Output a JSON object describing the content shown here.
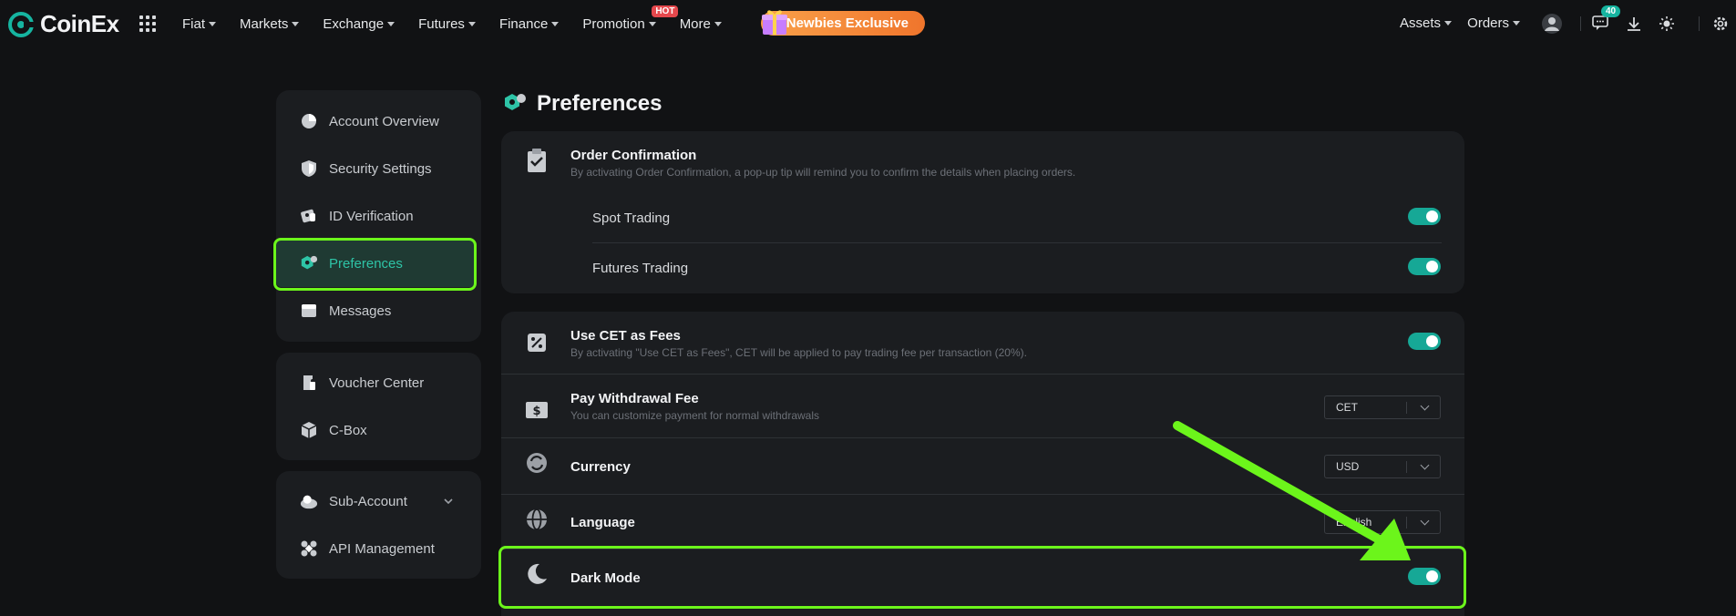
{
  "header": {
    "logo_text": "CoinEx",
    "nav": [
      {
        "label": "Fiat"
      },
      {
        "label": "Markets"
      },
      {
        "label": "Exchange"
      },
      {
        "label": "Futures"
      },
      {
        "label": "Finance"
      },
      {
        "label": "Promotion",
        "badge": "HOT"
      },
      {
        "label": "More"
      }
    ],
    "newbies_label": "Newbies Exclusive",
    "assets_label": "Assets",
    "orders_label": "Orders",
    "messages_count": "40"
  },
  "sidebar": {
    "group1": [
      {
        "label": "Account Overview",
        "icon": "pie-chart-icon"
      },
      {
        "label": "Security Settings",
        "icon": "shield-icon"
      },
      {
        "label": "ID Verification",
        "icon": "id-card-icon"
      },
      {
        "label": "Preferences",
        "icon": "preferences-icon",
        "active": true
      },
      {
        "label": "Messages",
        "icon": "message-icon"
      }
    ],
    "group2": [
      {
        "label": "Voucher Center",
        "icon": "voucher-icon"
      },
      {
        "label": "C-Box",
        "icon": "box-icon"
      }
    ],
    "group3": [
      {
        "label": "Sub-Account",
        "icon": "sub-account-icon"
      },
      {
        "label": "API Management",
        "icon": "api-icon"
      }
    ]
  },
  "main": {
    "title": "Preferences",
    "order_confirmation": {
      "title": "Order Confirmation",
      "desc": "By activating Order Confirmation, a pop-up tip will remind you to confirm the details when placing orders.",
      "spot_label": "Spot Trading",
      "spot_on": true,
      "futures_label": "Futures Trading",
      "futures_on": true
    },
    "cet_fees": {
      "title": "Use CET as Fees",
      "desc": "By activating \"Use CET as Fees\", CET will be applied to pay trading fee per transaction (20%).",
      "on": true
    },
    "withdrawal_fee": {
      "title": "Pay Withdrawal Fee",
      "desc": "You can customize payment for normal withdrawals",
      "value": "CET"
    },
    "currency": {
      "title": "Currency",
      "value": "USD"
    },
    "language": {
      "title": "Language",
      "value": "English"
    },
    "dark_mode": {
      "title": "Dark Mode",
      "on": true
    }
  },
  "colors": {
    "accent": "#16a896",
    "highlight": "#6cf51b",
    "background": "#111214",
    "card": "#1b1d20"
  }
}
